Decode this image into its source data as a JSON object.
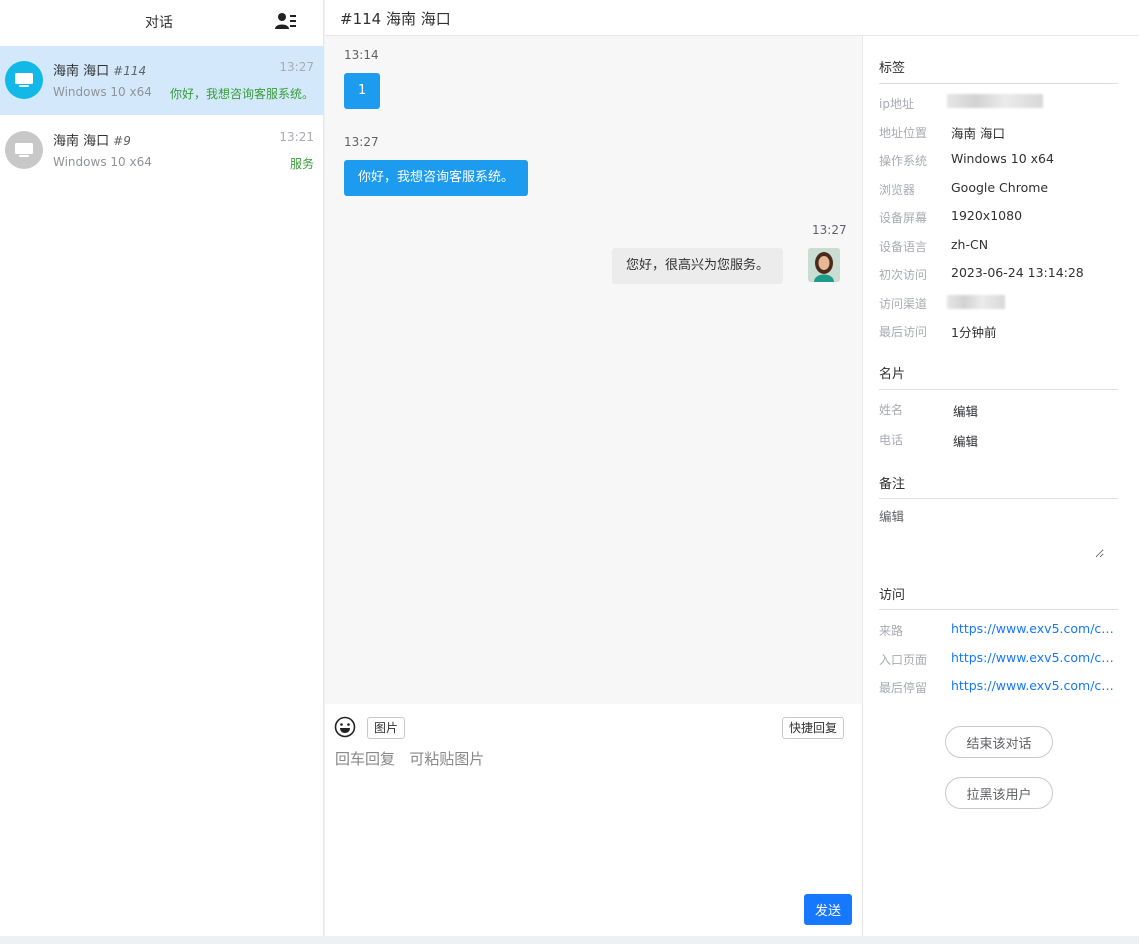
{
  "sidebar": {
    "title": "对话",
    "contacts_icon": "contacts-list-icon",
    "conversations": [
      {
        "location": "海南 海口",
        "id": "#114",
        "time": "13:27",
        "os": "Windows 10 x64",
        "preview": "你好，我想咨询客服系统。",
        "avatar_color": "#11b8e8",
        "active": true
      },
      {
        "location": "海南 海口",
        "id": "#9",
        "time": "13:21",
        "os": "Windows 10 x64",
        "preview": "服务",
        "avatar_color": "#c8c8c8",
        "active": false
      }
    ]
  },
  "header": {
    "title": "#114 海南 海口"
  },
  "chat": {
    "messages": [
      {
        "time": "13:14",
        "text": "1",
        "from": "visitor"
      },
      {
        "time": "13:27",
        "text": "你好，我想咨询客服系统。",
        "from": "visitor"
      },
      {
        "time": "13:27",
        "text": "您好，很高兴为您服务。",
        "from": "agent"
      }
    ]
  },
  "composer": {
    "emoji_icon": "smile-icon",
    "image_button": "图片",
    "quick_reply_button": "快捷回复",
    "placeholder": "回车回复   可粘贴图片",
    "send_button": "发送"
  },
  "info": {
    "tags_title": "标签",
    "fields": [
      {
        "key": "ip地址",
        "value": ""
      },
      {
        "key": "地址位置",
        "value": "海南 海口"
      },
      {
        "key": "操作系统",
        "value": "Windows 10 x64"
      },
      {
        "key": "浏览器",
        "value": "Google Chrome"
      },
      {
        "key": "设备屏幕",
        "value": "1920x1080"
      },
      {
        "key": "设备语言",
        "value": "zh-CN"
      },
      {
        "key": "初次访问",
        "value": "2023-06-24 13:14:28"
      },
      {
        "key": "访问渠道",
        "value": ""
      },
      {
        "key": "最后访问",
        "value": "1分钟前"
      }
    ],
    "card_title": "名片",
    "card_fields": [
      {
        "key": "姓名",
        "value": "编辑"
      },
      {
        "key": "电话",
        "value": "编辑"
      }
    ],
    "note_title": "备注",
    "note_placeholder": "编辑",
    "visit_title": "访问",
    "visit_fields": [
      {
        "key": "来路",
        "value": "https://www.exv5.com/ch..."
      },
      {
        "key": "入口页面",
        "value": "https://www.exv5.com/ch..."
      },
      {
        "key": "最后停留",
        "value": "https://www.exv5.com/ch..."
      }
    ],
    "end_button": "结束该对话",
    "block_button": "拉黑该用户"
  }
}
